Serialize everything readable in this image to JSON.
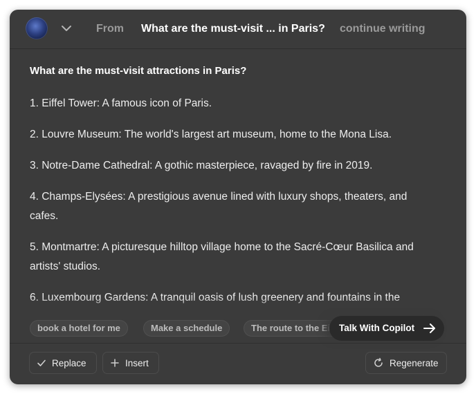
{
  "header": {
    "from_label": "From",
    "title": "What are the must-visit ... in Paris?",
    "continue_label": "continue writing"
  },
  "content": {
    "question": "What are the must-visit attractions in Paris?",
    "answer_items": [
      "1. Eiffel Tower: A famous icon of Paris.",
      "2. Louvre Museum: The world's largest art museum, home to the Mona Lisa.",
      "3. Notre-Dame Cathedral: A gothic masterpiece, ravaged by fire in 2019.",
      "4. Champs-Elysées: A prestigious avenue lined with luxury shops, theaters, and cafes.",
      "5. Montmartre: A picturesque hilltop village home to the Sacré-Cœur Basilica and artists' studios.",
      "6. Luxembourg Gardens: A tranquil oasis of lush greenery and fountains in the"
    ]
  },
  "suggestions": [
    "book a hotel for me",
    "Make a schedule",
    "The route to the Eiffel Tower"
  ],
  "talk_button": {
    "label": "Talk With Copilot"
  },
  "footer": {
    "replace_label": "Replace",
    "insert_label": "Insert",
    "regenerate_label": "Regenerate"
  },
  "icons": {
    "avatar": "avatar-icon",
    "chevron": "chevron-down-icon",
    "arrow": "arrow-right-icon",
    "check": "check-icon",
    "plus": "plus-icon",
    "refresh": "refresh-icon"
  },
  "colors": {
    "panel_bg": "#3b3b3b",
    "talk_bg": "#2a2a2a",
    "muted_text": "#9a9a9a"
  }
}
